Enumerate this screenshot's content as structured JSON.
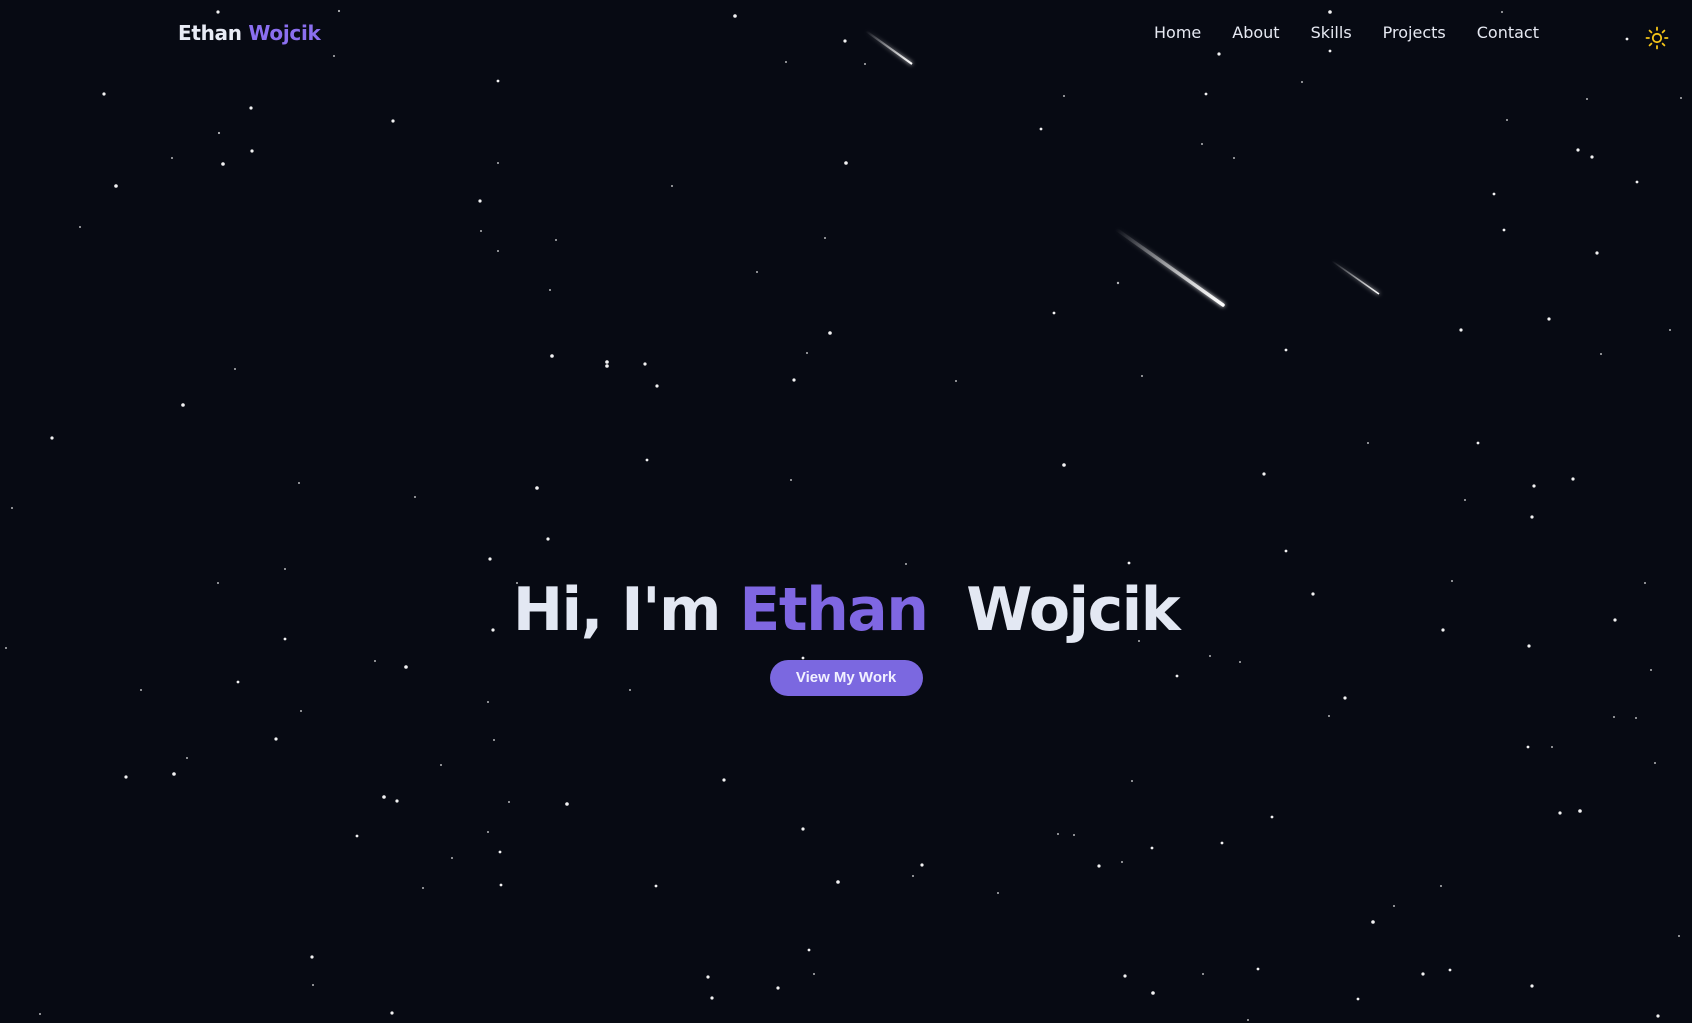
{
  "logo": {
    "first": "Ethan",
    "last": "Wojcik"
  },
  "nav": {
    "items": [
      {
        "label": "Home"
      },
      {
        "label": "About"
      },
      {
        "label": "Skills"
      },
      {
        "label": "Projects"
      },
      {
        "label": "Contact"
      }
    ],
    "theme_toggle_icon": "sun-icon"
  },
  "hero": {
    "greeting": "Hi, I'm",
    "first_name": "Ethan",
    "last_name": "Wojcik",
    "cta_label": "View My Work"
  },
  "colors": {
    "background": "#070a13",
    "accent": "#7b68e0",
    "text": "#e3e8f3",
    "sun_icon": "#f5c518",
    "star": "#ffffff"
  }
}
